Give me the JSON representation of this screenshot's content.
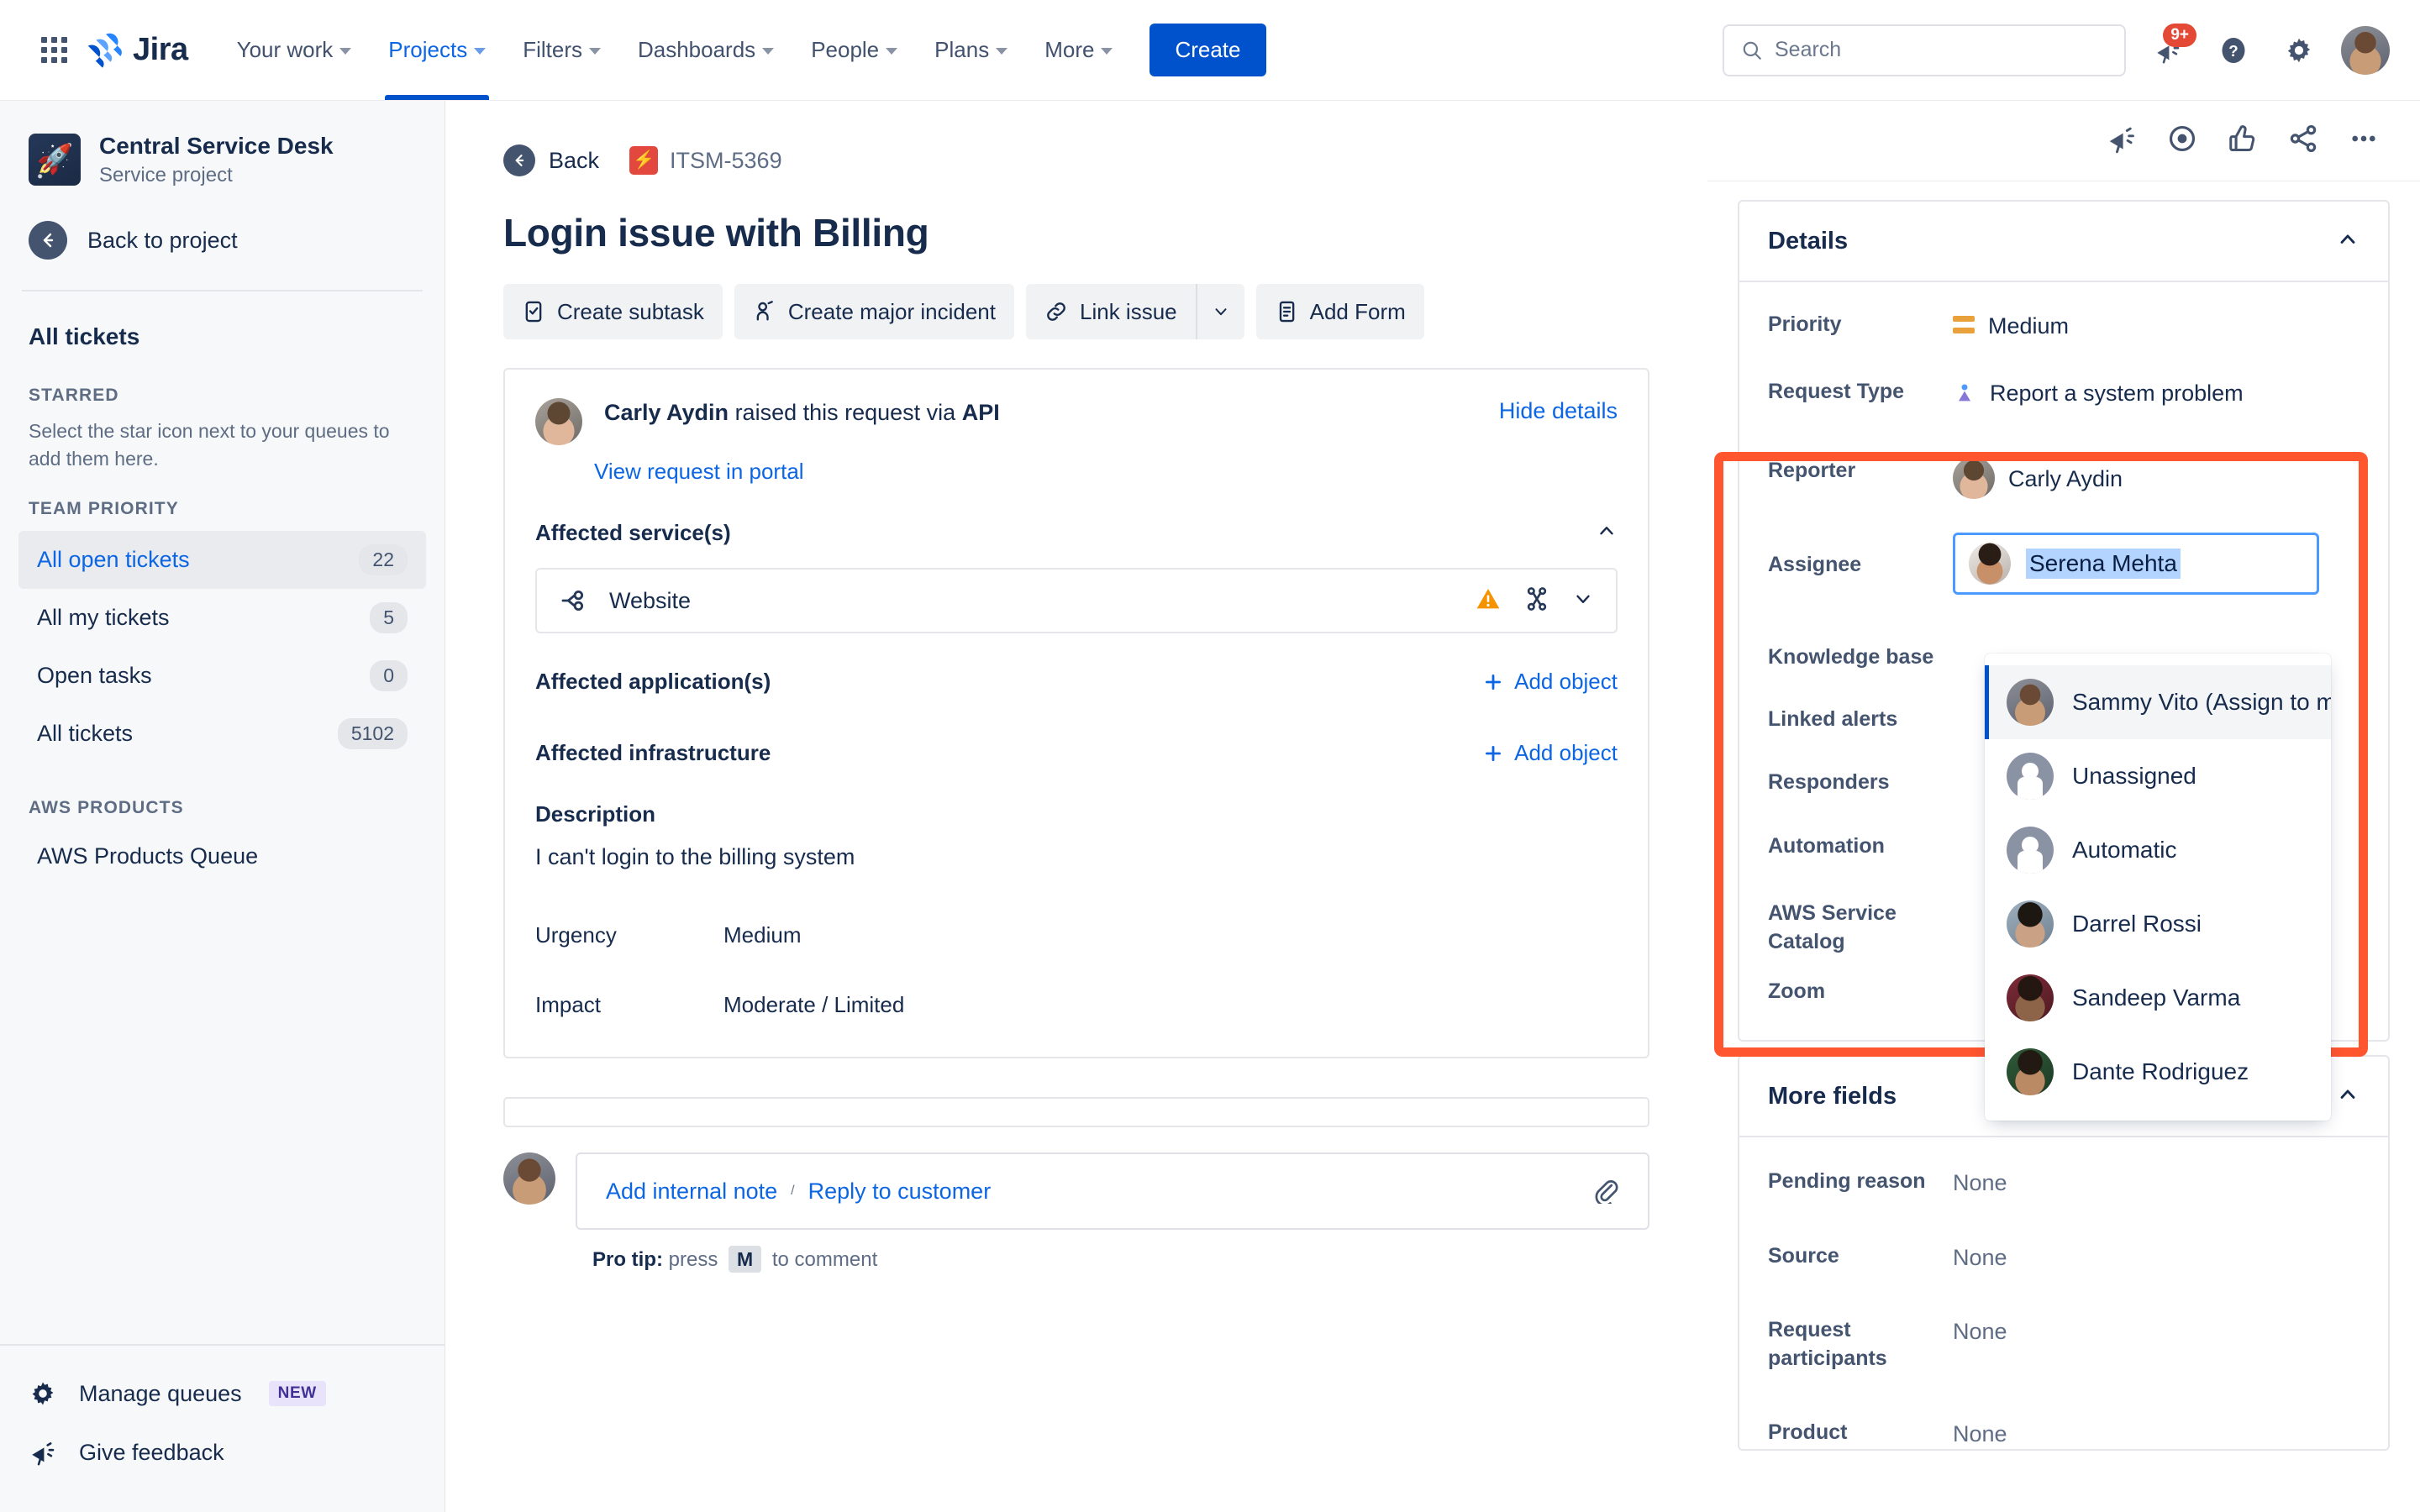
{
  "topnav": {
    "app_switcher_icon": "grid-apps-icon",
    "logo_text": "Jira",
    "items": [
      {
        "label": "Your work",
        "has_caret": true,
        "active": false
      },
      {
        "label": "Projects",
        "has_caret": true,
        "active": true
      },
      {
        "label": "Filters",
        "has_caret": true,
        "active": false
      },
      {
        "label": "Dashboards",
        "has_caret": true,
        "active": false
      },
      {
        "label": "People",
        "has_caret": true,
        "active": false
      },
      {
        "label": "Plans",
        "has_caret": true,
        "active": false
      },
      {
        "label": "More",
        "has_caret": true,
        "active": false
      }
    ],
    "create_label": "Create",
    "search_placeholder": "Search",
    "notifications_badge": "9+",
    "icons": [
      "notifications-bell-icon",
      "help-icon",
      "settings-gear-icon",
      "user-avatar"
    ]
  },
  "sidebar": {
    "project_name": "Central Service Desk",
    "project_type": "Service project",
    "back_to_project": "Back to project",
    "all_tickets_title": "All tickets",
    "starred_header": "STARRED",
    "starred_hint": "Select the star icon next to your queues to add them here.",
    "team_priority_header": "TEAM PRIORITY",
    "queues": [
      {
        "label": "All open tickets",
        "count": "22",
        "selected": true
      },
      {
        "label": "All my tickets",
        "count": "5",
        "selected": false
      },
      {
        "label": "Open tasks",
        "count": "0",
        "selected": false
      },
      {
        "label": "All tickets",
        "count": "5102",
        "selected": false
      }
    ],
    "aws_header": "AWS PRODUCTS",
    "aws_queue": "AWS Products Queue",
    "manage_queues": "Manage queues",
    "manage_queues_tag": "NEW",
    "give_feedback": "Give feedback"
  },
  "main": {
    "back_label": "Back",
    "issue_key": "ITSM-5369",
    "issue_title": "Login issue with Billing",
    "actions": [
      {
        "label": "Create subtask",
        "icon": "subtask-icon"
      },
      {
        "label": "Create major incident",
        "icon": "person-add-icon"
      },
      {
        "label": "Link issue",
        "icon": "link-icon",
        "split": true
      },
      {
        "label": "Add Form",
        "icon": "form-icon"
      }
    ],
    "request": {
      "reporter": "Carly Aydin",
      "raised_text": "raised this request via",
      "channel": "API",
      "hide_details": "Hide details",
      "portal_link": "View request in portal"
    },
    "affected_services_label": "Affected service(s)",
    "service_name": "Website",
    "service_icons": [
      "warning-icon",
      "impacted-nodes-icon",
      "chevron-down-icon"
    ],
    "affected_applications_label": "Affected application(s)",
    "affected_infrastructure_label": "Affected infrastructure",
    "add_object_label": "Add object",
    "description_label": "Description",
    "description_text": "I can't login to the billing system",
    "urgency_label": "Urgency",
    "urgency_value": "Medium",
    "impact_label": "Impact",
    "impact_value": "Moderate / Limited",
    "comment": {
      "add_internal_note": "Add internal note",
      "separator": "/",
      "reply_to_customer": "Reply to customer",
      "protip_prefix": "Pro tip:",
      "protip_press": "press",
      "protip_key": "M",
      "protip_suffix": "to comment"
    }
  },
  "right": {
    "toolbar_icons": [
      "megaphone-icon",
      "watch-eye-icon",
      "like-thumbsup-icon",
      "share-icon",
      "more-actions-icon"
    ],
    "details": {
      "title": "Details",
      "rows": [
        {
          "label": "Priority",
          "value": "Medium",
          "icon": "priority-medium-icon"
        },
        {
          "label": "Request Type",
          "value": "Report a system problem",
          "icon": "request-type-icon"
        },
        {
          "label": "Reporter",
          "value": "Carly Aydin",
          "icon": "avatar-carly"
        },
        {
          "label": "Assignee",
          "value": "Serena Mehta",
          "icon": "avatar-serena",
          "editing": true
        },
        {
          "label": "Knowledge base",
          "value": ""
        },
        {
          "label": "Linked alerts",
          "value": ""
        },
        {
          "label": "Responders",
          "value": ""
        },
        {
          "label": "Automation",
          "value": ""
        },
        {
          "label": "AWS Service Catalog",
          "value": ""
        },
        {
          "label": "Zoom",
          "value": ""
        }
      ]
    },
    "assignee_dropdown": {
      "options": [
        {
          "label": "Sammy Vito (Assign to me)",
          "avatar": "av-sammy",
          "highlighted": true
        },
        {
          "label": "Unassigned",
          "avatar": "generic",
          "highlighted": false
        },
        {
          "label": "Automatic",
          "avatar": "generic",
          "highlighted": false
        },
        {
          "label": "Darrel Rossi",
          "avatar": "av-darrel",
          "highlighted": false
        },
        {
          "label": "Sandeep Varma",
          "avatar": "av-sandeep",
          "highlighted": false
        },
        {
          "label": "Dante Rodriguez",
          "avatar": "av-dante",
          "highlighted": false
        }
      ]
    },
    "more_fields": {
      "title": "More fields",
      "rows": [
        {
          "label": "Pending reason",
          "value": "None"
        },
        {
          "label": "Source",
          "value": "None"
        },
        {
          "label": "Request participants",
          "value": "None"
        },
        {
          "label": "Product",
          "value": "None"
        }
      ]
    }
  },
  "colors": {
    "brand_blue": "#0052cc",
    "link_blue": "#0c66e4",
    "highlight_orange": "#ff5630",
    "priority_medium": "#e9a23b",
    "badge_red": "#e34935"
  }
}
